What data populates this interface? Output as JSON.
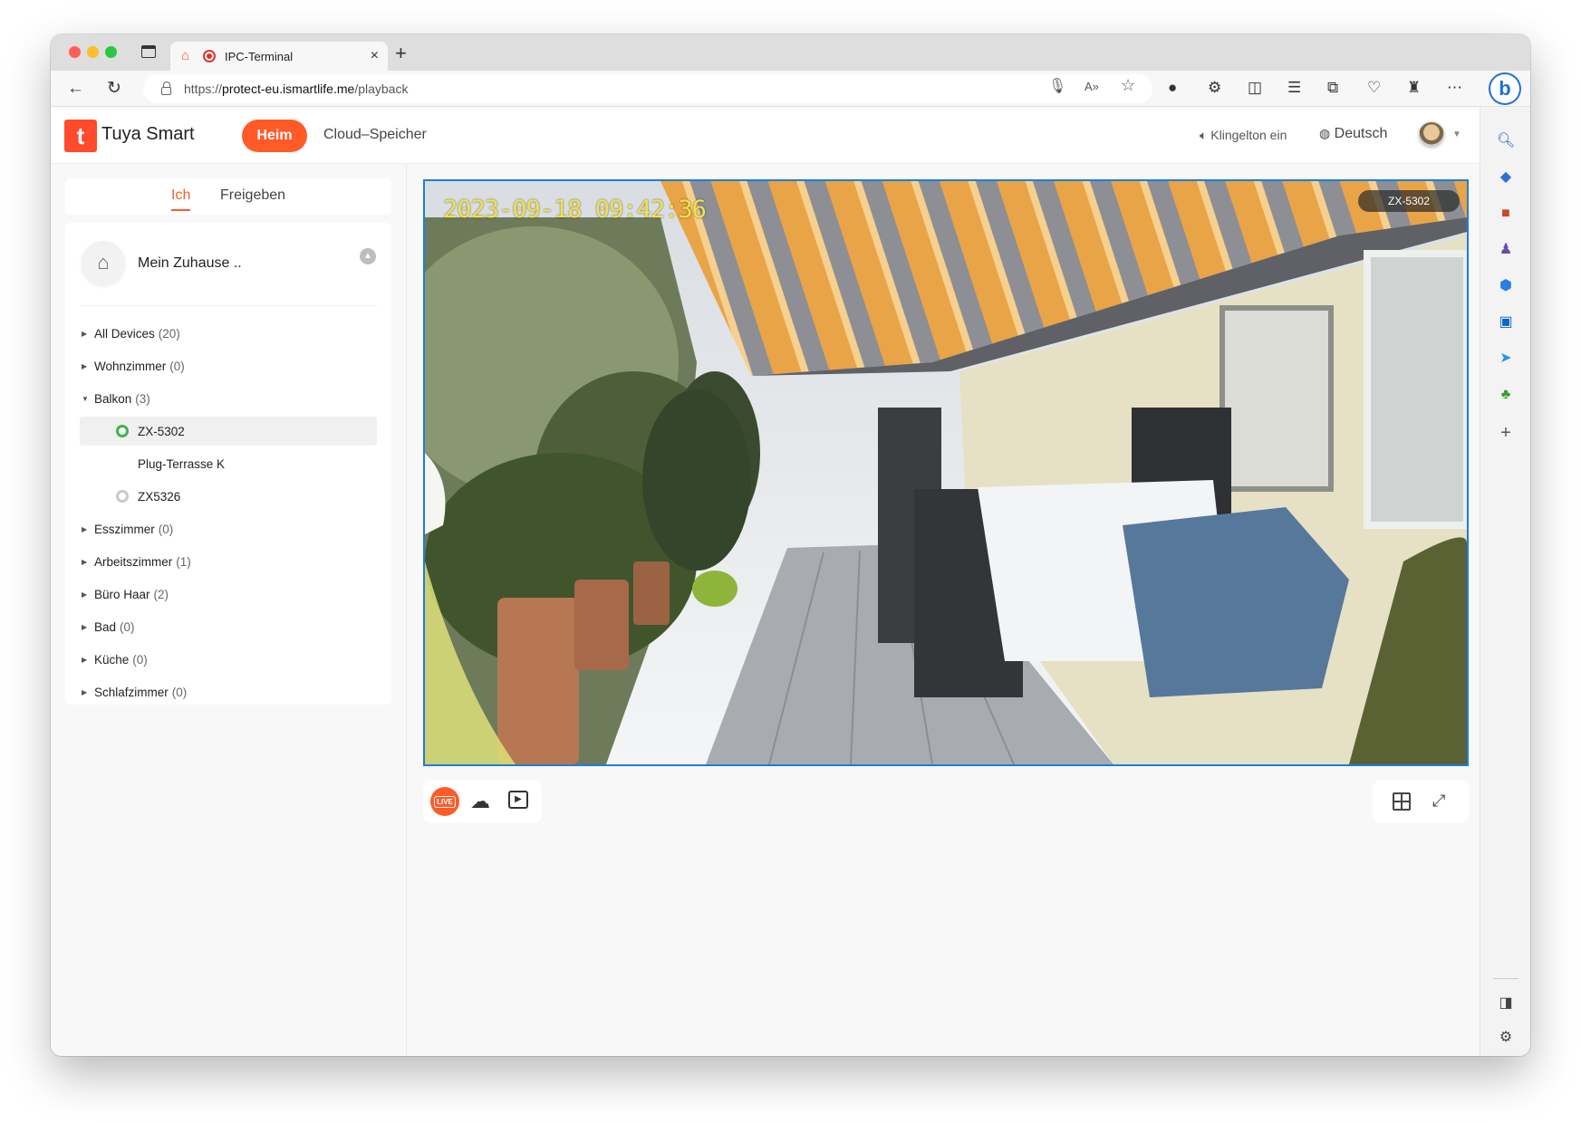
{
  "browser": {
    "tab_title": "IPC-Terminal",
    "tab_close": "×",
    "new_tab": "+",
    "url_scheme": "https://",
    "url_host": "protect-eu.ismartlife.me",
    "url_path": "/playback"
  },
  "header": {
    "logo_letter": "t",
    "logo_text": "Tuya Smart",
    "nav_home": "Heim",
    "nav_cloud": "Cloud–Speicher",
    "ringtone": "Klingelton ein",
    "language": "Deutsch"
  },
  "segment": {
    "me": "Ich",
    "share": "Freigeben"
  },
  "home": {
    "name": "Mein Zuhause .."
  },
  "rooms": [
    {
      "name": "All Devices",
      "count": "(20)"
    },
    {
      "name": "Wohnzimmer",
      "count": "(0)"
    },
    {
      "name": "Balkon",
      "count": "(3)"
    },
    {
      "name": "Esszimmer",
      "count": "(0)"
    },
    {
      "name": "Arbeitszimmer",
      "count": "(1)"
    },
    {
      "name": "Büro Haar",
      "count": "(2)"
    },
    {
      "name": "Bad",
      "count": "(0)"
    },
    {
      "name": "Küche",
      "count": "(0)"
    },
    {
      "name": "Schlafzimmer",
      "count": "(0)"
    }
  ],
  "devices": [
    {
      "name": "ZX-5302",
      "status": "online"
    },
    {
      "name": "Plug-Terrasse K",
      "status": "none"
    },
    {
      "name": "ZX5326",
      "status": "offline"
    }
  ],
  "video": {
    "timestamp": "2023-09-18 09:42:36",
    "camera_name": "ZX-5302"
  },
  "controls": {
    "live_label": "LIVE"
  },
  "colors": {
    "accent": "#ff5a28",
    "online": "#3db34a",
    "selection_border": "#1d7ed8"
  }
}
